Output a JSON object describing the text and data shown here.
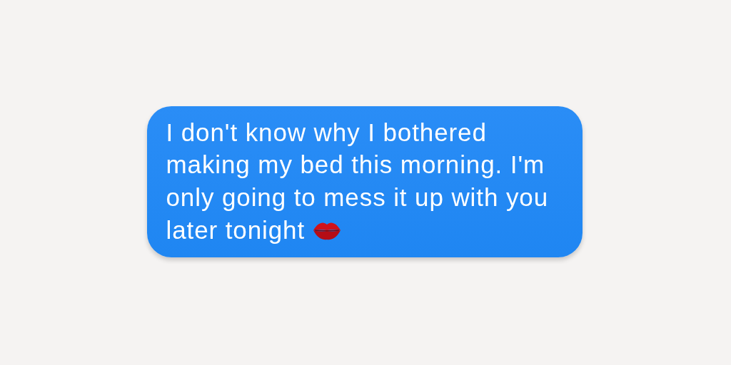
{
  "message": {
    "lines": [
      "I don't know why I bothered",
      "making my bed this morning. I'm",
      "only going to mess it up with you",
      "later tonight"
    ],
    "sent": true
  }
}
